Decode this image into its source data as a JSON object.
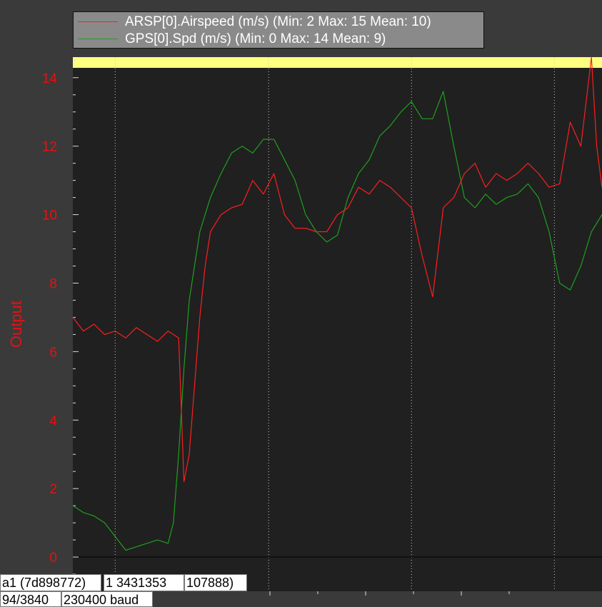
{
  "chart_data": {
    "type": "line",
    "ylabel": "Output",
    "ylim": [
      -1.0,
      14.6
    ],
    "yticks": [
      0,
      2,
      4,
      6,
      8,
      10,
      12,
      14
    ],
    "ytick_labels": [
      "0",
      "2",
      "4",
      "6",
      "8",
      "10",
      "12",
      "14"
    ],
    "x_domain": [
      0,
      100
    ],
    "series": [
      {
        "name": "ARSP[0].Airspeed (m/s) (Min: 2 Max: 15 Mean: 10)",
        "color": "#ff1e1e",
        "x": [
          0,
          2,
          4,
          6,
          8,
          10,
          12,
          14,
          16,
          18,
          20,
          21,
          22,
          23,
          24,
          25,
          26,
          28,
          30,
          32,
          34,
          36,
          38,
          40,
          42,
          44,
          46,
          48,
          50,
          52,
          54,
          56,
          58,
          60,
          62,
          64,
          66,
          68,
          70,
          72,
          74,
          76,
          78,
          80,
          82,
          84,
          86,
          88,
          90,
          92,
          94,
          96,
          98,
          99,
          100
        ],
        "values": [
          7.0,
          6.6,
          6.8,
          6.5,
          6.6,
          6.4,
          6.7,
          6.5,
          6.3,
          6.6,
          6.4,
          2.2,
          3.0,
          5.0,
          7.0,
          8.5,
          9.5,
          10.0,
          10.2,
          10.3,
          11.0,
          10.6,
          11.2,
          10.0,
          9.6,
          9.6,
          9.5,
          9.5,
          10.0,
          10.2,
          10.8,
          10.6,
          11.0,
          10.8,
          10.5,
          10.2,
          8.8,
          7.6,
          10.2,
          10.5,
          11.2,
          11.5,
          10.8,
          11.2,
          11.0,
          11.2,
          11.5,
          11.2,
          10.8,
          10.9,
          12.7,
          12.0,
          14.6,
          12.0,
          10.8
        ]
      },
      {
        "name": "GPS[0].Spd (m/s) (Min: 0 Max: 14 Mean: 9)",
        "color": "#1ea01e",
        "x": [
          0,
          2,
          4,
          6,
          8,
          10,
          12,
          14,
          16,
          18,
          19,
          20,
          21,
          22,
          23,
          24,
          26,
          28,
          30,
          32,
          34,
          36,
          38,
          40,
          42,
          44,
          46,
          48,
          50,
          52,
          54,
          56,
          58,
          60,
          62,
          64,
          66,
          68,
          70,
          72,
          74,
          76,
          78,
          80,
          82,
          84,
          86,
          88,
          90,
          92,
          94,
          96,
          98,
          100
        ],
        "values": [
          1.5,
          1.3,
          1.2,
          1.0,
          0.6,
          0.2,
          0.3,
          0.4,
          0.5,
          0.4,
          1.0,
          3.0,
          5.5,
          7.5,
          8.5,
          9.5,
          10.5,
          11.2,
          11.8,
          12.0,
          11.8,
          12.2,
          12.2,
          11.6,
          11.0,
          10.0,
          9.5,
          9.2,
          9.4,
          10.5,
          11.2,
          11.6,
          12.3,
          12.6,
          13.0,
          13.3,
          12.8,
          12.8,
          13.6,
          12.0,
          10.5,
          10.2,
          10.6,
          10.3,
          10.5,
          10.6,
          10.9,
          10.5,
          9.5,
          8.0,
          7.8,
          8.5,
          9.5,
          10.0
        ]
      }
    ],
    "highlight_band_color": "#ffff80",
    "grid": true
  },
  "status_bar": {
    "box1": "a1 (7d898772) ",
    "box2": "1 3431353 ",
    "box3": "107888)",
    "box4": "94/3840 ",
    "box5": "230400 baud"
  }
}
